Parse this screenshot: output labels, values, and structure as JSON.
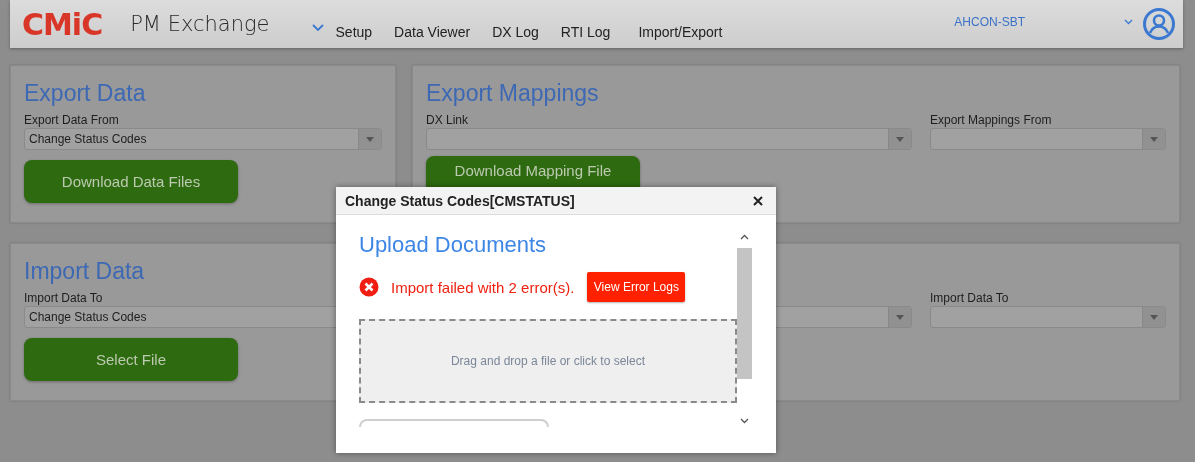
{
  "header": {
    "logo": "CMiC",
    "app_title": "PM Exchange",
    "nav": [
      {
        "label": "Setup"
      },
      {
        "label": "Data Viewer"
      },
      {
        "label": "DX Log"
      },
      {
        "label": "RTI Log"
      },
      {
        "label": "Import/Export"
      }
    ],
    "company": "AHCON-SBT"
  },
  "export_data": {
    "title": "Export Data",
    "field_label": "Export Data From",
    "field_value": "Change Status Codes",
    "button": "Download Data Files"
  },
  "export_mappings": {
    "title": "Export Mappings",
    "fields": [
      {
        "label": "DX Link"
      },
      {
        "label": "Export Mappings From"
      }
    ],
    "button": "Download Mapping File"
  },
  "import_data": {
    "title": "Import Data",
    "field_label": "Import Data To",
    "field_value": "Change Status Codes",
    "button": "Select File"
  },
  "panel_4": {
    "field_label": "Import Data To"
  },
  "dialog": {
    "title": "Change Status Codes[CMSTATUS]",
    "heading": "Upload Documents",
    "error": "Import failed with 2 error(s).",
    "error_button": "View Error Logs",
    "dropzone": "Drag and drop a file or click to select"
  }
}
